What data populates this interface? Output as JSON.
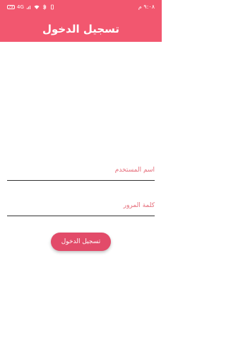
{
  "status_bar": {
    "battery": "79",
    "network": "4G",
    "time": "٩:٠٨ م"
  },
  "header": {
    "title": "تسجيل الدخول"
  },
  "form": {
    "username_placeholder": "اسم المستخدم",
    "password_placeholder": "كلمة المرور",
    "login_label": "تسجيل الدخول"
  },
  "colors": {
    "appbar": "#f2576f",
    "button": "#e24b69",
    "placeholder": "#e56b78"
  }
}
